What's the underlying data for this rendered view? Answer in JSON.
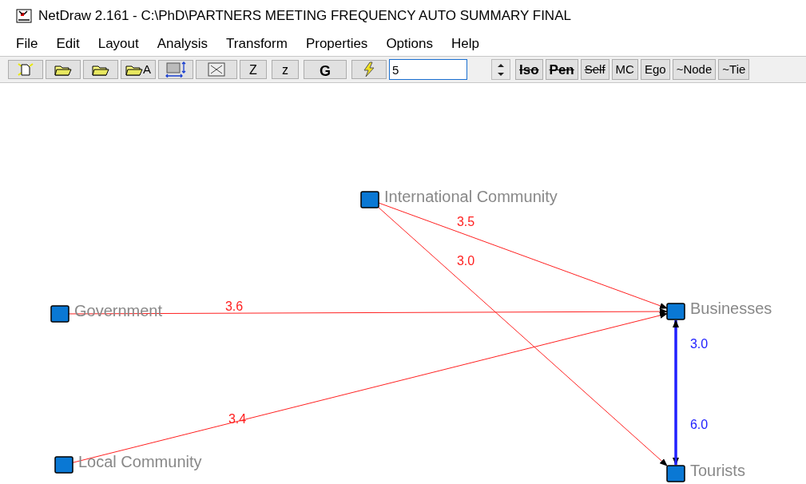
{
  "window": {
    "title": "NetDraw 2.161 - C:\\PhD\\PARTNERS MEETING FREQUENCY AUTO SUMMARY FINAL"
  },
  "menu": [
    "File",
    "Edit",
    "Layout",
    "Analysis",
    "Transform",
    "Properties",
    "Options",
    "Help"
  ],
  "toolbar": {
    "folder_letter": "A",
    "text_buttons": [
      "Z",
      "z",
      "G"
    ],
    "size_field": "5",
    "filter_buttons": [
      {
        "label": "Iso",
        "struck": true
      },
      {
        "label": "Pen",
        "struck": true
      },
      {
        "label": "Self",
        "struck": true
      },
      {
        "label": "MC",
        "struck": false
      },
      {
        "label": "Ego",
        "struck": false
      },
      {
        "label": "~Node",
        "struck": false
      },
      {
        "label": "~Tie",
        "struck": false
      }
    ]
  },
  "network": {
    "nodes": [
      {
        "label": "International Community"
      },
      {
        "label": "Government"
      },
      {
        "label": "Local Community"
      },
      {
        "label": "Businesses"
      },
      {
        "label": "Tourists"
      }
    ],
    "ties": [
      {
        "value": "3.5",
        "color": "#ff2020"
      },
      {
        "value": "3.0",
        "color": "#ff2020"
      },
      {
        "value": "3.6",
        "color": "#ff2020"
      },
      {
        "value": "3.4",
        "color": "#ff2020"
      },
      {
        "value": "3.0",
        "color": "#2020ff"
      },
      {
        "value": "6.0",
        "color": "#2020ff"
      }
    ]
  }
}
